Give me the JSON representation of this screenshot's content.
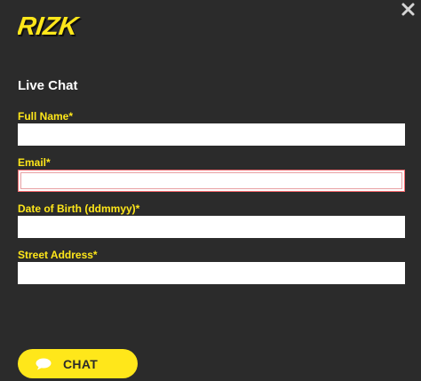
{
  "brand": {
    "logo_text": "RIZK",
    "accent_color": "#ffe71a",
    "background_color": "#2b2b2b",
    "error_color": "#ff6d72"
  },
  "header": {
    "close_icon": "close-icon"
  },
  "form": {
    "title": "Live Chat",
    "fields": [
      {
        "label": "Full Name*",
        "value": "",
        "placeholder": ""
      },
      {
        "label": "Email*",
        "value": "",
        "placeholder": "",
        "state": "error"
      },
      {
        "label": "Date of Birth (ddmmyy)*",
        "value": "",
        "placeholder": ""
      },
      {
        "label": "Street Address*",
        "value": "",
        "placeholder": ""
      }
    ]
  },
  "actions": {
    "chat_label": "CHAT",
    "chat_icon": "speech-bubble-icon"
  }
}
